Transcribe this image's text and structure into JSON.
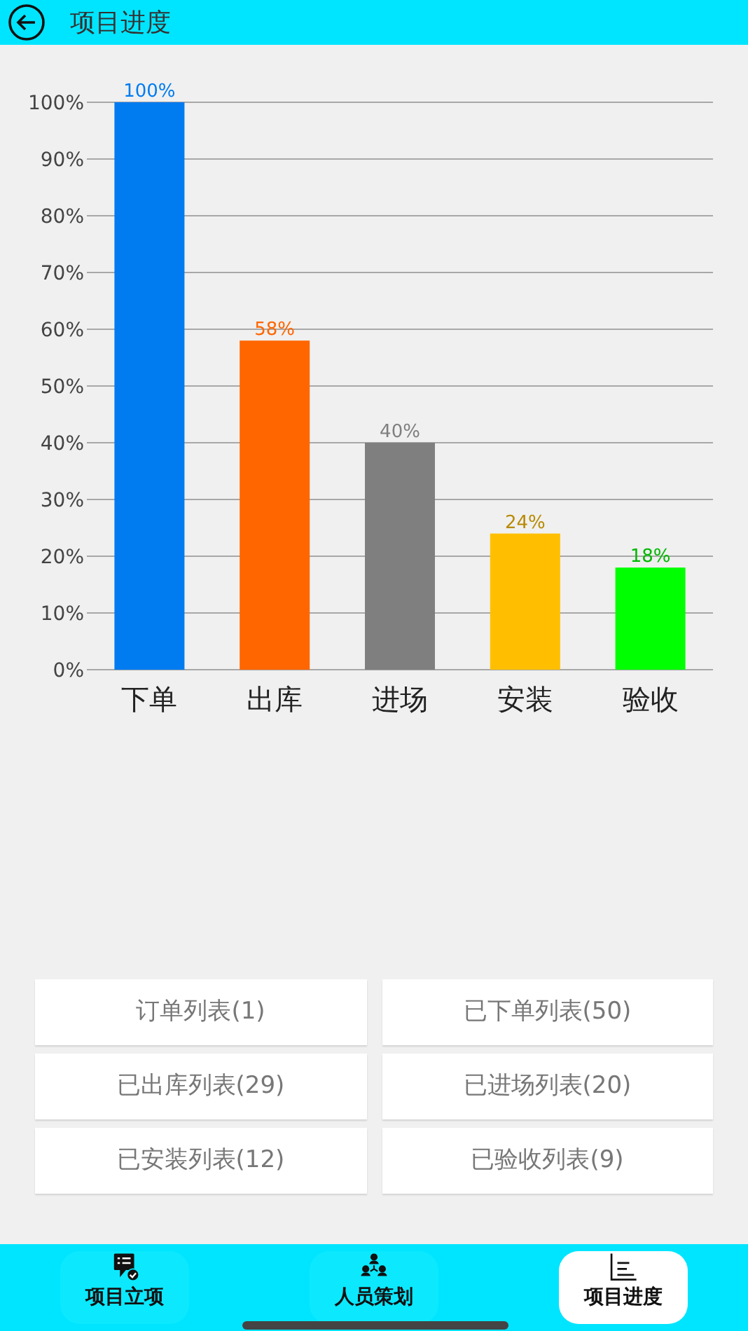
{
  "header": {
    "title": "项目进度"
  },
  "chart": {
    "chart_data": {
      "type": "bar",
      "categories": [
        "下单",
        "出库",
        "进场",
        "安装",
        "验收"
      ],
      "grid": true,
      "series": [
        {
          "values": [
            100,
            58,
            40,
            24,
            18
          ],
          "colors": [
            "#007bf0",
            "#ff6600",
            "#7f7f7f",
            "#ffbf00",
            "#00ff00"
          ]
        }
      ],
      "ylim": [
        0,
        100
      ],
      "yticks": [
        {
          "value": 0,
          "label": "0%"
        },
        {
          "value": 10,
          "label": "10%"
        },
        {
          "value": 20,
          "label": "20%"
        },
        {
          "value": 30,
          "label": "30%"
        },
        {
          "value": 40,
          "label": "40%"
        },
        {
          "value": 50,
          "label": "50%"
        },
        {
          "value": 60,
          "label": "60%"
        },
        {
          "value": 70,
          "label": "70%"
        },
        {
          "value": 80,
          "label": "80%"
        },
        {
          "value": 90,
          "label": "90%"
        },
        {
          "value": 100,
          "label": "100%"
        }
      ],
      "value_labels": [
        "100%",
        "58%",
        "40%",
        "24%",
        "18%"
      ]
    }
  },
  "lists": [
    {
      "label": "订单列表(1)"
    },
    {
      "label": "已下单列表(50)"
    },
    {
      "label": "已出库列表(29)"
    },
    {
      "label": "已进场列表(20)"
    },
    {
      "label": "已安装列表(12)"
    },
    {
      "label": "已验收列表(9)"
    }
  ],
  "tabs": [
    {
      "label": "项目立项",
      "selected": false
    },
    {
      "label": "人员策划",
      "selected": false
    },
    {
      "label": "项目进度",
      "selected": true
    }
  ]
}
